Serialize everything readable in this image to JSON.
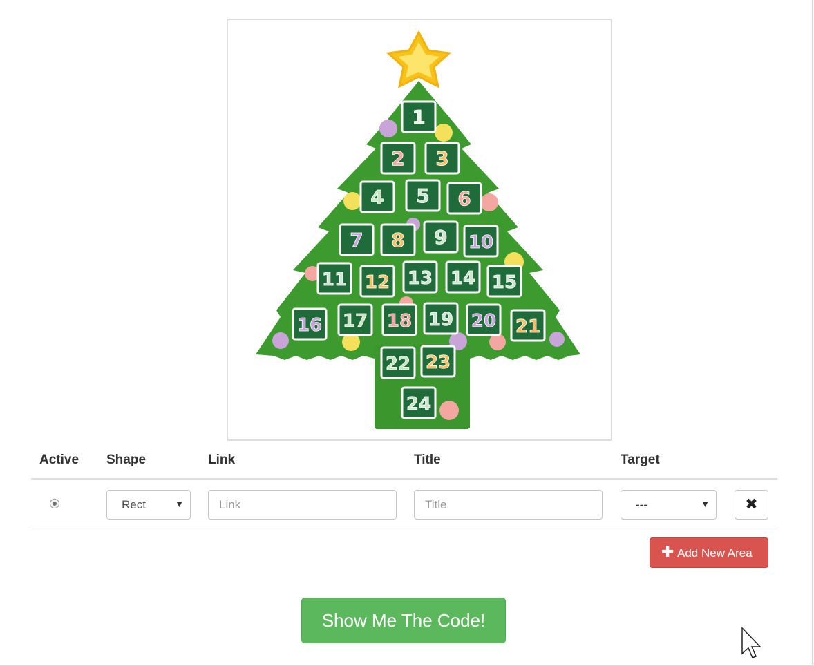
{
  "image": {
    "alt_icon": "christmas-tree-advent-calendar",
    "numbers": [
      "1",
      "2",
      "3",
      "4",
      "5",
      "6",
      "7",
      "8",
      "9",
      "10",
      "11",
      "12",
      "13",
      "14",
      "15",
      "16",
      "17",
      "18",
      "19",
      "20",
      "21",
      "22",
      "23",
      "24"
    ]
  },
  "table": {
    "headers": {
      "active": "Active",
      "shape": "Shape",
      "link": "Link",
      "title": "Title",
      "target": "Target"
    },
    "row": {
      "shape_value": "Rect",
      "link_placeholder": "Link",
      "title_placeholder": "Title",
      "target_value": "---",
      "remove_icon": "✖"
    }
  },
  "buttons": {
    "add_new_area": "Add New Area",
    "add_icon": "✚",
    "show_code": "Show Me The Code!"
  },
  "colors": {
    "tree_green": "#3d9a2f",
    "box_green": "#1f6b3a",
    "star_yellow": "#f7c31b",
    "danger": "#d9534f",
    "success": "#5cb85c"
  }
}
